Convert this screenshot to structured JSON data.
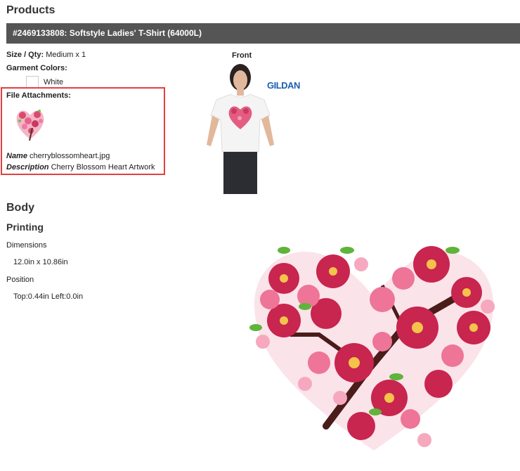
{
  "header": {
    "title": "Products"
  },
  "product": {
    "title": "#2469133808: Softstyle Ladies' T-Shirt (64000L)",
    "size_qty_label": "Size / Qty:",
    "size_qty_value": "Medium x 1",
    "garment_colors_label": "Garment Colors:",
    "color_name": "White",
    "file_attachments_label": "File Attachments:",
    "name_label": "Name",
    "name_value": "cherryblossomheart.jpg",
    "description_label": "Description",
    "description_value": "Cherry Blossom Heart Artwork",
    "front_label": "Front",
    "brand_logo": "GILDAN"
  },
  "body_section": {
    "title": "Body",
    "printing_title": "Printing",
    "dimensions_label": "Dimensions",
    "dimensions_value": "12.0in x 10.86in",
    "position_label": "Position",
    "position_value": "Top:0.44in Left:0.0in"
  },
  "colors": {
    "bar": "#555555",
    "highlight": "#e04040",
    "brand": "#1b5fb0"
  }
}
